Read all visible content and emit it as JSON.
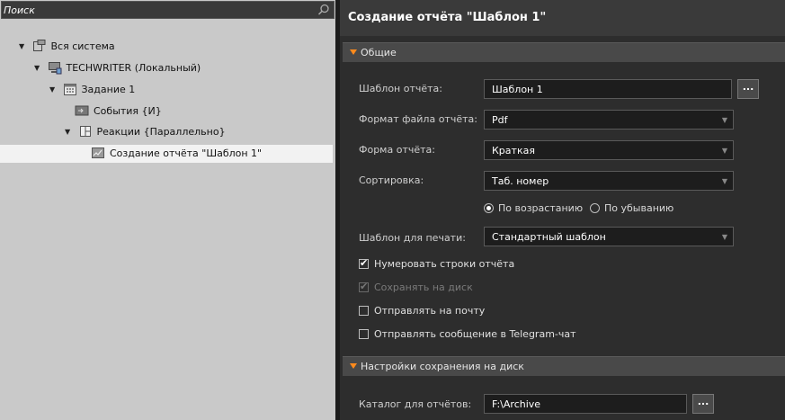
{
  "tree": {
    "search_placeholder": "Поиск",
    "items": [
      {
        "label": "Вся система",
        "icon": "system-icon"
      },
      {
        "label": "TECHWRITER (Локальный)",
        "icon": "computer-icon"
      },
      {
        "label": "Задание 1",
        "icon": "calendar-icon"
      },
      {
        "label": "События {И}",
        "icon": "events-icon"
      },
      {
        "label": "Реакции {Параллельно}",
        "icon": "reactions-icon"
      },
      {
        "label": "Создание отчёта \"Шаблон 1\"",
        "icon": "report-icon"
      }
    ]
  },
  "panel": {
    "title": "Создание отчёта \"Шаблон 1\"",
    "section_general": "Общие",
    "section_save": "Настройки сохранения на диск",
    "fields": {
      "template_label": "Шаблон отчёта:",
      "template_value": "Шаблон 1",
      "format_label": "Формат файла отчёта:",
      "format_value": "Pdf",
      "form_label": "Форма отчёта:",
      "form_value": "Краткая",
      "sort_label": "Сортировка:",
      "sort_value": "Таб. номер",
      "sort_asc": "По возрастанию",
      "sort_desc": "По убыванию",
      "print_label": "Шаблон для печати:",
      "print_value": "Стандартный шаблон",
      "folder_label": "Каталог для отчётов:",
      "folder_value": "F:\\Archive",
      "browse": "..."
    },
    "checkboxes": [
      {
        "label": "Нумеровать строки отчёта",
        "checked": true,
        "enabled": true
      },
      {
        "label": "Сохранять на диск",
        "checked": true,
        "enabled": false
      },
      {
        "label": "Отправлять на почту",
        "checked": false,
        "enabled": true
      },
      {
        "label": "Отправлять сообщение в Telegram-чат",
        "checked": false,
        "enabled": true
      }
    ]
  },
  "colors": {
    "accent": "#ff8a1c",
    "selection": "#f2f2f2"
  }
}
